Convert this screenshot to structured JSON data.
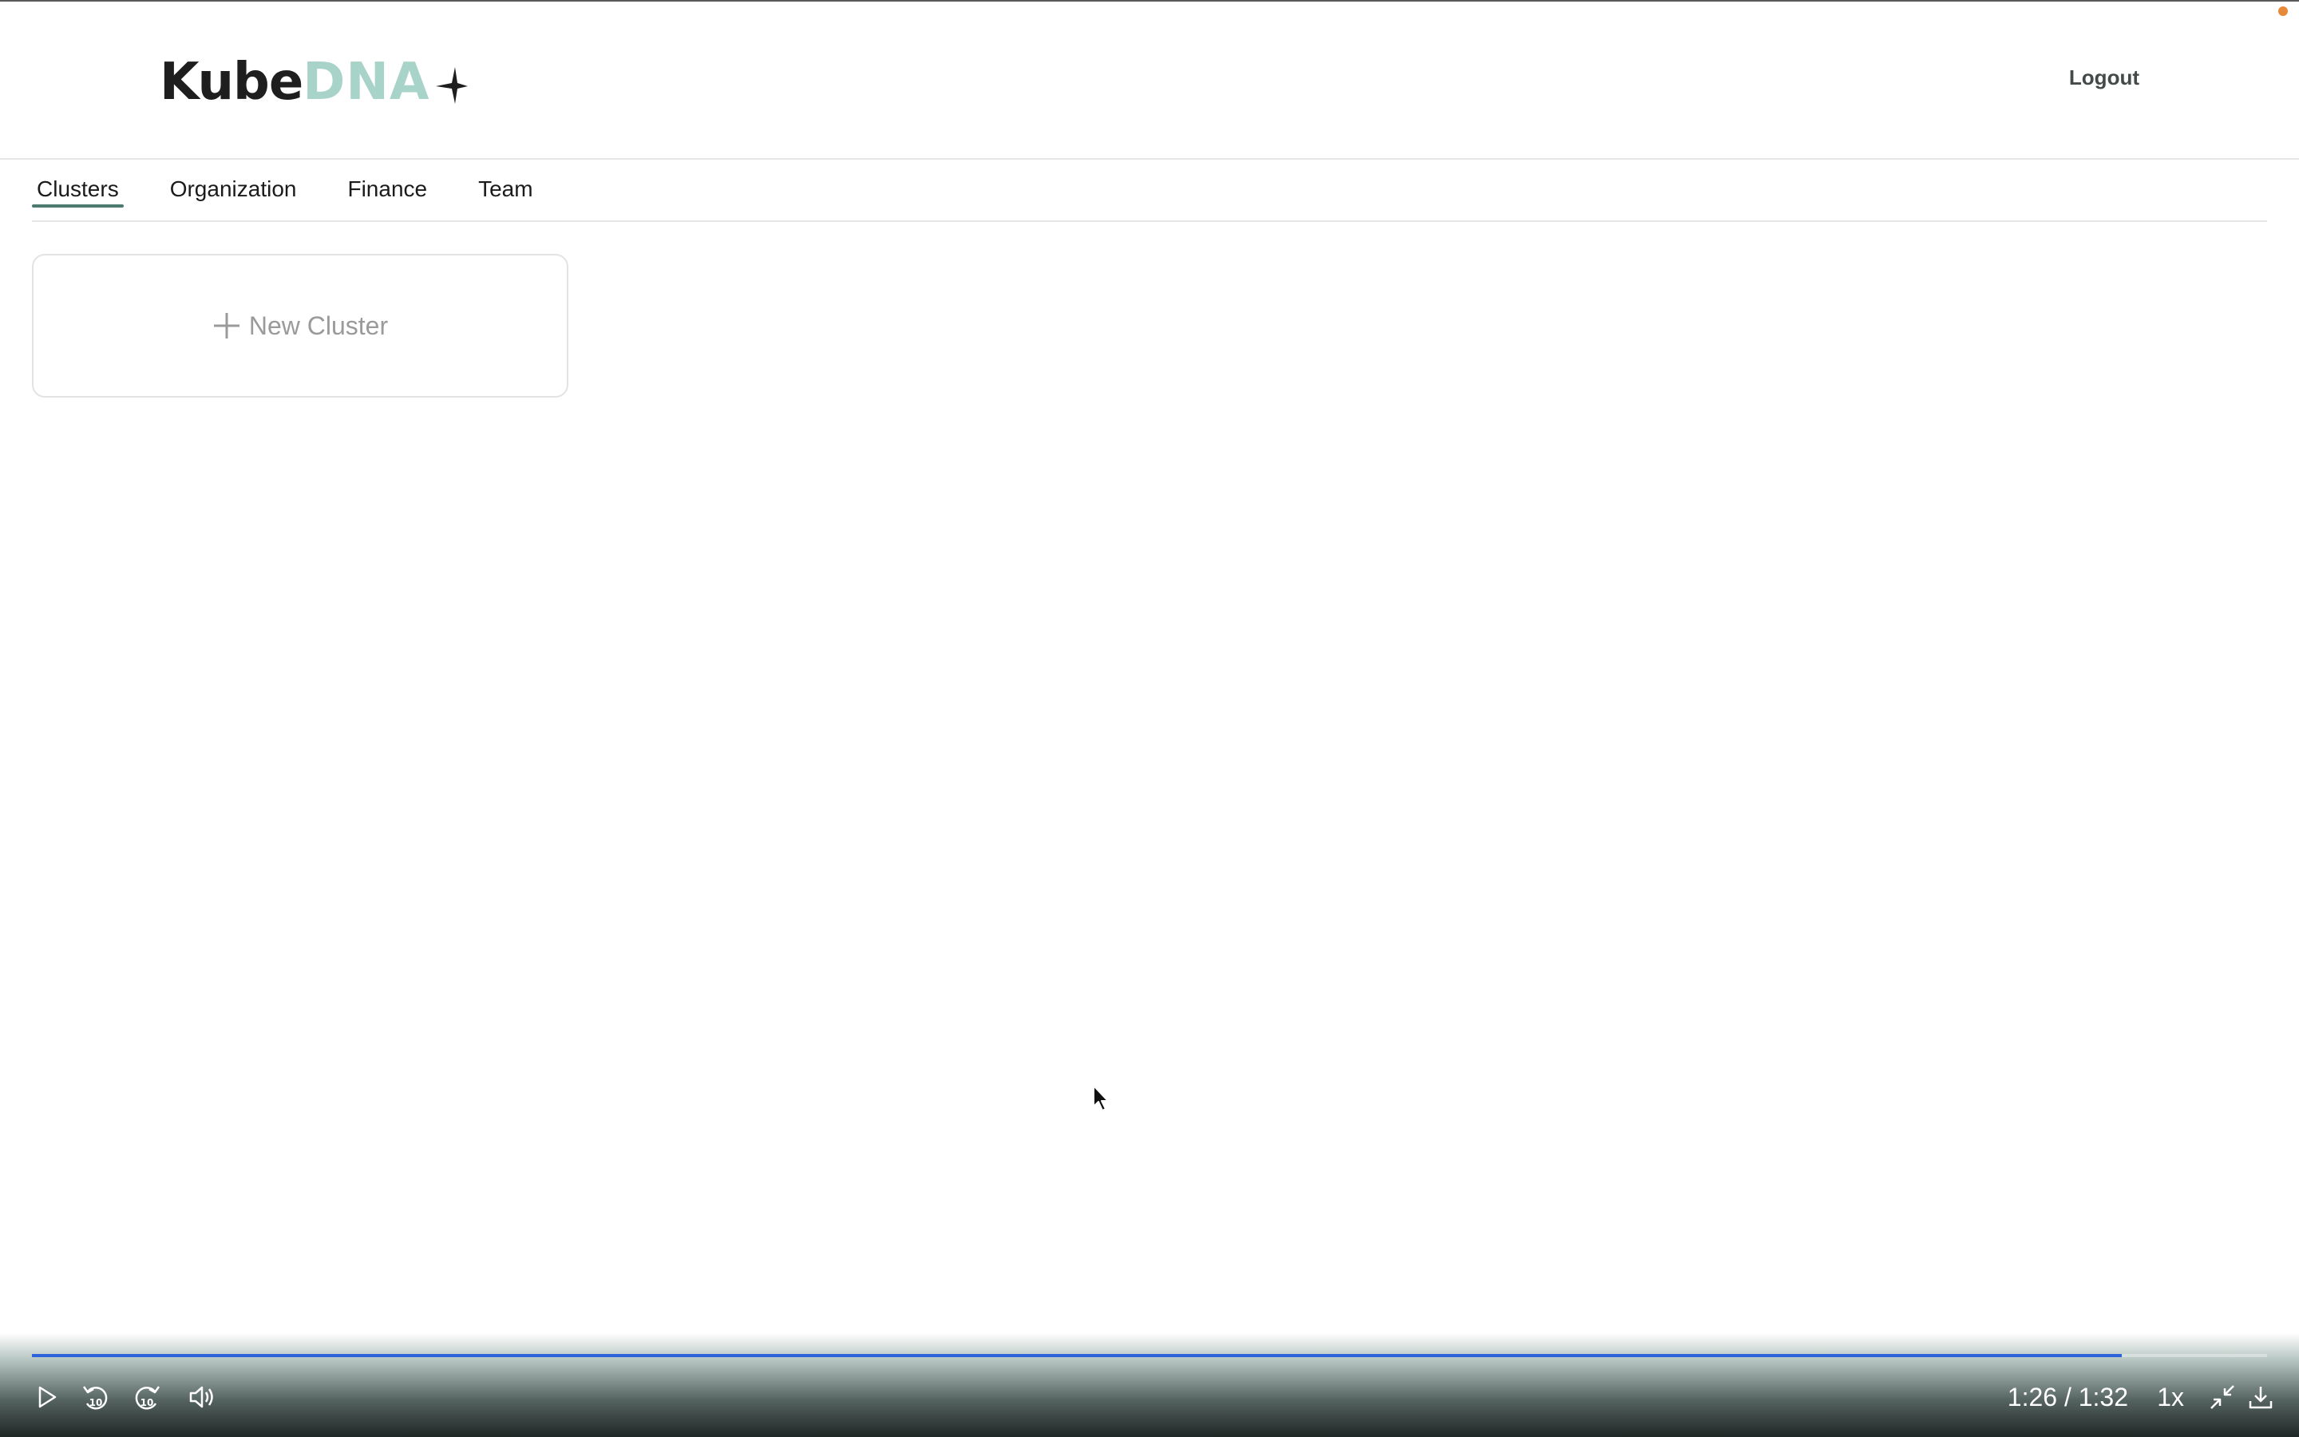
{
  "app": {
    "logo_part1": "Kube",
    "logo_part2": "DNA",
    "logo_icon": "sparkle-star-icon",
    "logout_label": "Logout"
  },
  "nav": {
    "tabs": [
      {
        "label": "Clusters",
        "active": true
      },
      {
        "label": "Organization",
        "active": false
      },
      {
        "label": "Finance",
        "active": false
      },
      {
        "label": "Team",
        "active": false
      }
    ]
  },
  "main": {
    "new_cluster_label": "New Cluster",
    "new_cluster_icon": "plus-icon"
  },
  "player": {
    "progress": 0.935,
    "time_display": "1:26 / 1:32",
    "speed_label": "1x",
    "icons": [
      "play-icon",
      "rewind-10-icon",
      "forward-10-icon",
      "volume-icon",
      "exit-fullscreen-icon",
      "download-icon"
    ]
  },
  "colors": {
    "brand_dark": "#1e1e1e",
    "brand_accent": "#a8d3c8",
    "tab_underline": "#4d7a6e",
    "progress": "#2f63d9",
    "recording_dot": "#e8893a"
  }
}
